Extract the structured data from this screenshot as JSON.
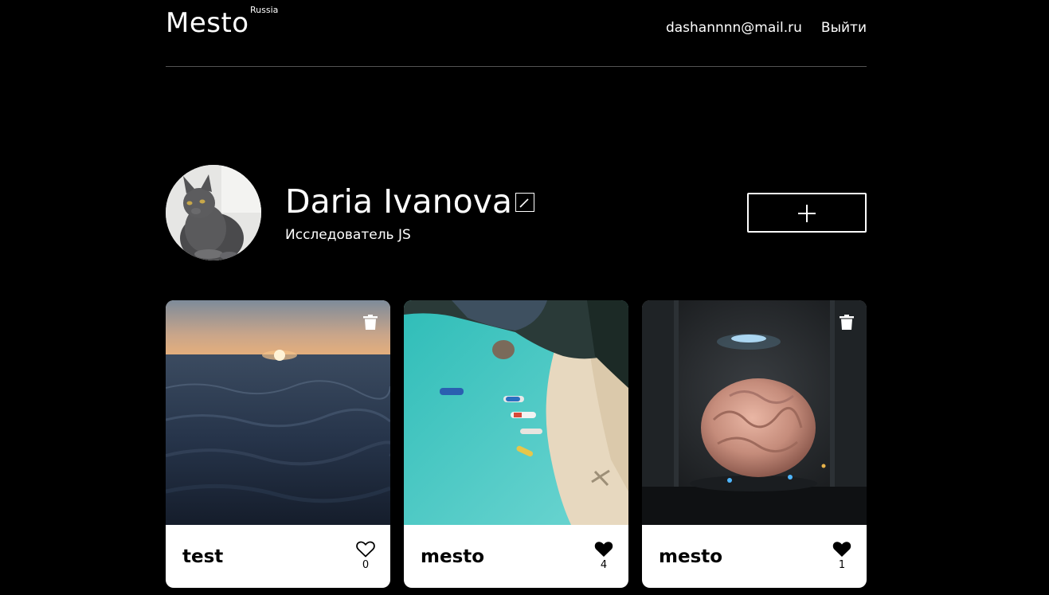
{
  "header": {
    "logo": "Mesto",
    "region": "Russia",
    "email": "dashannnn@mail.ru",
    "logout": "Выйти"
  },
  "profile": {
    "name": "Daria Ivanova",
    "about": "Исследователь JS"
  },
  "cards": [
    {
      "title": "test",
      "likes": "0",
      "liked": false,
      "deletable": true,
      "image": "sunset-sea"
    },
    {
      "title": "mesto",
      "likes": "4",
      "liked": true,
      "deletable": false,
      "image": "aerial-beach-boats"
    },
    {
      "title": "mesto",
      "likes": "1",
      "liked": true,
      "deletable": true,
      "image": "brain-in-hangar"
    }
  ],
  "icons": {
    "edit": "pencil-icon",
    "add": "plus-icon",
    "delete": "trash-icon",
    "like": "heart-icon"
  },
  "colors": {
    "background": "#000000",
    "text": "#ffffff",
    "card": "#ffffff",
    "divider": "#545454"
  }
}
